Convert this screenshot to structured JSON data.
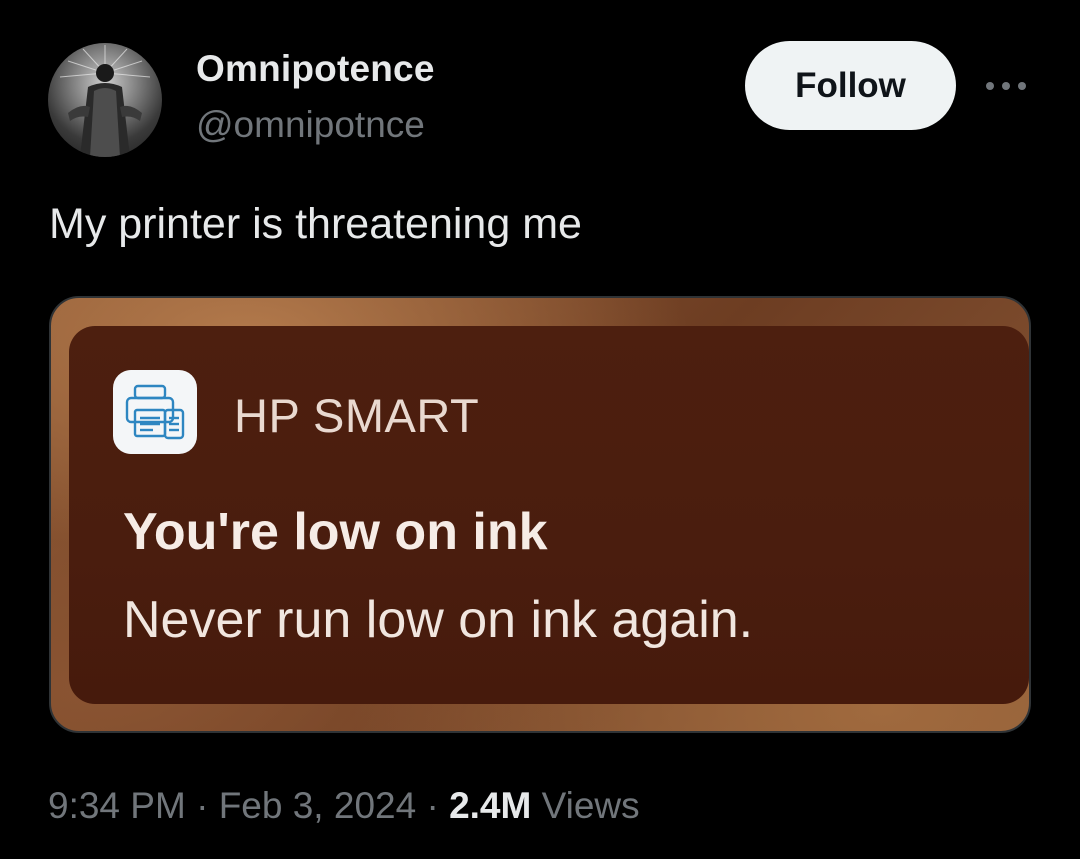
{
  "author": {
    "display_name": "Omnipotence",
    "handle": "@omnipotnce"
  },
  "follow_button": {
    "label": "Follow"
  },
  "tweet": {
    "text": "My printer is threatening me"
  },
  "notification": {
    "app_name": "HP SMART",
    "title": "You're low on ink",
    "body": "Never run low on ink again."
  },
  "meta": {
    "time": "9:34 PM",
    "separator": "·",
    "date": "Feb 3, 2024",
    "views_count": "2.4M",
    "views_label": "Views"
  },
  "colors": {
    "background": "#000000",
    "primary_text": "#e7e9ea",
    "secondary_text": "#71767b",
    "follow_bg": "#eff3f4",
    "notification_bg": "#4a1d0e"
  },
  "icons": {
    "more": "more-icon",
    "app": "printer-app-icon",
    "avatar": "avatar"
  }
}
